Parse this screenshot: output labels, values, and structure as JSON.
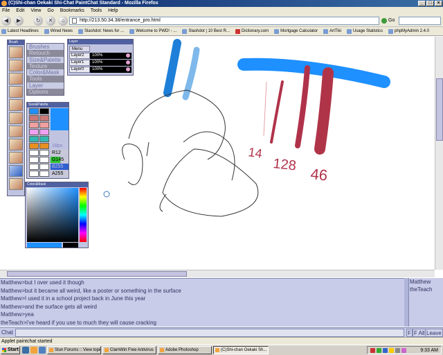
{
  "window": {
    "title": "(C)Shi-chan Oekaki Shi-Chat PaintChat Standard - Mozilla Firefox",
    "buttons": [
      "_",
      "□",
      "×"
    ]
  },
  "menu": [
    "File",
    "Edit",
    "View",
    "Go",
    "Bookmarks",
    "Tools",
    "Help"
  ],
  "nav": {
    "url": "http://213.50.34.38/entrance_pro.html",
    "go_label": "Go"
  },
  "bookmarks": [
    "Latest Headlines",
    "Wired News",
    "Slashdot: News for ...",
    "Welcome to PWD! - ...",
    "Slashdot | 10 Best R...",
    "Dictionary.com",
    "Mortgage Calculator",
    "ArtTiki",
    "Usage Statistics",
    "phpMyAdmin 2.4.0"
  ],
  "palettes": {
    "tools_title": "Brush",
    "menu_items": [
      "Brushes",
      "Retouch",
      "Size&Palette",
      "Texture",
      "Color&Mask",
      "Tools",
      "Layer",
      "Options"
    ],
    "layer_title": "Layer",
    "layer_menu": "Menu",
    "layers": [
      {
        "name": "Layer2",
        "opacity": "100%"
      },
      {
        "name": "Layer1",
        "opacity": "100%"
      },
      {
        "name": "Layer0",
        "opacity": "100%"
      }
    ],
    "size_title": "Size&Palette",
    "size_value": "18px",
    "rgba": {
      "r": "R12",
      "g": "G145",
      "b": "B255",
      "a": "A255"
    },
    "color_title": "Color&Mask"
  },
  "drawing_annotations": [
    "14",
    "128",
    "46"
  ],
  "chat": {
    "messages": [
      "Matthew>but I over used it though",
      "Matthew>but it became all weird, like a poster or something in the surface",
      "Matthew>I used it in a school project back in June this year",
      "Matthew>and the surface gets all weird",
      "Matthew>yea",
      "theTeach>i've heard if you use to much they will cause cracking"
    ],
    "users": [
      "Matthew",
      "theTeach"
    ],
    "input_label": "Chat",
    "buttons": [
      "F",
      "F All",
      "Leave"
    ]
  },
  "status": "Applet paintchat started",
  "taskbar": {
    "start": "Start",
    "tasks": [
      "Stun Forums :: View topic...",
      "ClamWin Free Antivirus",
      "Adobe Photoshop",
      "(C)Shi-chan Oekaki Sh..."
    ],
    "clock": "9:33 AM"
  }
}
